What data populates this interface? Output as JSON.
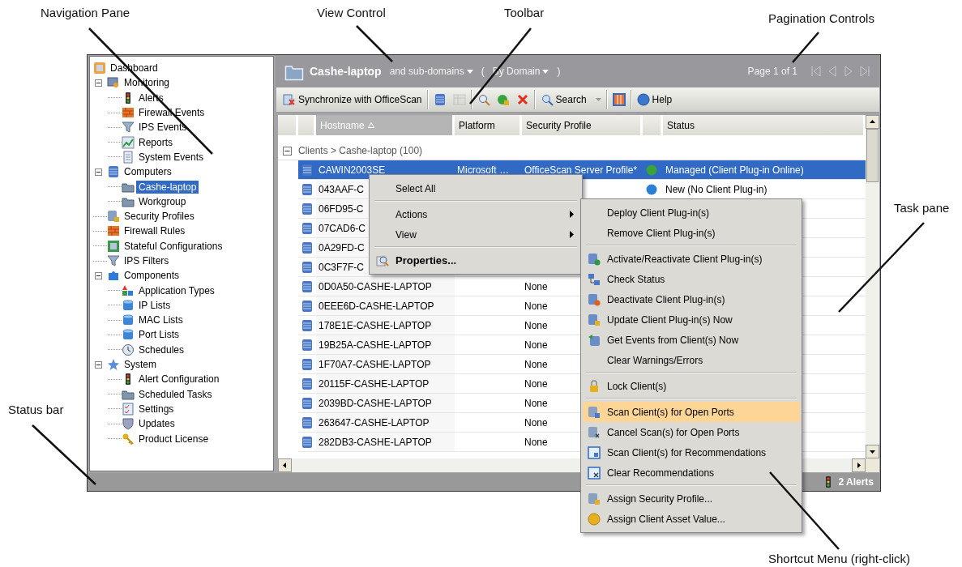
{
  "annotations": [
    {
      "label": "Navigation Pane"
    },
    {
      "label": "View Control"
    },
    {
      "label": "Toolbar"
    },
    {
      "label": "Pagination Controls"
    },
    {
      "label": "Task pane"
    },
    {
      "label": "Status bar"
    },
    {
      "label": "Shortcut Menu (right-click)"
    }
  ],
  "navigation": {
    "root": {
      "label": "Dashboard",
      "selected": false
    },
    "items": [
      {
        "label": "Monitoring",
        "selected": false,
        "expanded": true,
        "children": [
          {
            "label": "Alerts",
            "selected": false
          },
          {
            "label": "Firewall Events",
            "selected": false
          },
          {
            "label": "IPS Events",
            "selected": false
          },
          {
            "label": "Reports",
            "selected": false
          },
          {
            "label": "System Events",
            "selected": false
          }
        ]
      },
      {
        "label": "Computers",
        "selected": false,
        "expanded": true,
        "children": [
          {
            "label": "Cashe-laptop",
            "selected": true
          },
          {
            "label": "Workgroup",
            "selected": false
          }
        ]
      },
      {
        "label": "Security Profiles",
        "selected": false
      },
      {
        "label": "Firewall Rules",
        "selected": false
      },
      {
        "label": "Stateful Configurations",
        "selected": false
      },
      {
        "label": "IPS Filters",
        "selected": false
      },
      {
        "label": "Components",
        "selected": false,
        "expanded": true,
        "children": [
          {
            "label": "Application Types",
            "selected": false
          },
          {
            "label": "IP Lists",
            "selected": false
          },
          {
            "label": "MAC Lists",
            "selected": false
          },
          {
            "label": "Port Lists",
            "selected": false
          },
          {
            "label": "Schedules",
            "selected": false
          }
        ]
      },
      {
        "label": "System",
        "selected": false,
        "expanded": true,
        "children": [
          {
            "label": "Alert Configuration",
            "selected": false
          },
          {
            "label": "Scheduled Tasks",
            "selected": false
          },
          {
            "label": "Settings",
            "selected": false
          },
          {
            "label": "Updates",
            "selected": false
          },
          {
            "label": "Product License",
            "selected": false
          }
        ]
      }
    ]
  },
  "header": {
    "title": "Cashe-laptop",
    "scope": "and sub-domains",
    "group_open": "(",
    "group_by": "By Domain",
    "group_close": ")",
    "page": "Page 1 of 1"
  },
  "toolbar": [
    {
      "kind": "text",
      "label": "Synchronize with OfficeScan",
      "disabled": false
    },
    {
      "kind": "separator"
    },
    {
      "kind": "icon",
      "disabled": false
    },
    {
      "kind": "icon",
      "disabled": true
    },
    {
      "kind": "separator"
    },
    {
      "kind": "icon",
      "disabled": false
    },
    {
      "kind": "icon",
      "disabled": false
    },
    {
      "kind": "icon",
      "disabled": false
    },
    {
      "kind": "separator"
    },
    {
      "kind": "dropdown",
      "label": "Search",
      "disabled": false
    },
    {
      "kind": "separator"
    },
    {
      "kind": "icon",
      "disabled": false
    },
    {
      "kind": "separator"
    },
    {
      "kind": "text",
      "label": "Help",
      "disabled": false
    }
  ],
  "table": {
    "columns": [
      {
        "label": "Hostname",
        "sorted": true
      },
      {
        "label": "Platform",
        "sorted": false
      },
      {
        "label": "Security Profile",
        "sorted": false
      },
      {
        "label": "Status",
        "sorted": false
      }
    ],
    "group": {
      "label": "Clients > Cashe-laptop (100)",
      "expanded": true
    },
    "rows": [
      {
        "hostname": "CAWIN2003SE",
        "platform": "Microsoft …",
        "profile": "OfficeScan Server Profile*",
        "status": "Managed (Client Plug-in Online)",
        "color": "#3aa33a",
        "selected": true
      },
      {
        "hostname": "043AAF-C",
        "status": "New (No Client Plug-in)",
        "color": "#2d7fd6",
        "selected": false
      },
      {
        "hostname": "06FD95-C",
        "selected": false
      },
      {
        "hostname": "07CAD6-C",
        "selected": false
      },
      {
        "hostname": "0A29FD-C",
        "selected": false
      },
      {
        "hostname": "0C3F7F-C",
        "selected": false
      },
      {
        "hostname": "0D0A50-CASHE-LAPTOP",
        "profile": "None",
        "selected": false
      },
      {
        "hostname": "0EEE6D-CASHE-LAPTOP",
        "profile": "None",
        "selected": false
      },
      {
        "hostname": "178E1E-CASHE-LAPTOP",
        "profile": "None",
        "selected": false
      },
      {
        "hostname": "19B25A-CASHE-LAPTOP",
        "profile": "None",
        "selected": false
      },
      {
        "hostname": "1F70A7-CASHE-LAPTOP",
        "profile": "None",
        "selected": false
      },
      {
        "hostname": "20115F-CASHE-LAPTOP",
        "profile": "None",
        "selected": false
      },
      {
        "hostname": "2039BD-CASHE-LAPTOP",
        "profile": "None",
        "selected": false
      },
      {
        "hostname": "263647-CASHE-LAPTOP",
        "profile": "None",
        "selected": false
      },
      {
        "hostname": "282DB3-CASHE-LAPTOP",
        "profile": "None",
        "selected": false
      }
    ]
  },
  "status_bar": {
    "alerts": "2 Alerts"
  },
  "context_menu": {
    "items": [
      {
        "kind": "item",
        "label": "Select All",
        "submenu": false,
        "default": false
      },
      {
        "kind": "separator"
      },
      {
        "kind": "item",
        "label": "Actions",
        "submenu": true,
        "default": false
      },
      {
        "kind": "item",
        "label": "View",
        "submenu": true,
        "default": false
      },
      {
        "kind": "separator"
      },
      {
        "kind": "item",
        "label": "Properties...",
        "submenu": false,
        "default": true
      }
    ]
  },
  "submenu": {
    "items": [
      {
        "kind": "item",
        "label": "Deploy Client Plug-in(s)",
        "selected": false
      },
      {
        "kind": "item",
        "label": "Remove Client Plug-in(s)",
        "selected": false
      },
      {
        "kind": "separator"
      },
      {
        "kind": "item",
        "label": "Activate/Reactivate Client Plug-in(s)",
        "selected": false
      },
      {
        "kind": "item",
        "label": "Check Status",
        "selected": false
      },
      {
        "kind": "item",
        "label": "Deactivate Client Plug-in(s)",
        "selected": false
      },
      {
        "kind": "item",
        "label": "Update Client Plug-in(s) Now",
        "selected": false
      },
      {
        "kind": "item",
        "label": "Get Events from Client(s) Now",
        "selected": false
      },
      {
        "kind": "item",
        "label": "Clear Warnings/Errors",
        "selected": false
      },
      {
        "kind": "separator"
      },
      {
        "kind": "item",
        "label": "Lock Client(s)",
        "selected": false
      },
      {
        "kind": "separator"
      },
      {
        "kind": "item",
        "label": "Scan Client(s) for Open Ports",
        "selected": true
      },
      {
        "kind": "item",
        "label": "Cancel Scan(s) for Open Ports",
        "selected": false
      },
      {
        "kind": "item",
        "label": "Scan Client(s) for Recommendations",
        "selected": false
      },
      {
        "kind": "item",
        "label": "Clear Recommendations",
        "selected": false
      },
      {
        "kind": "separator"
      },
      {
        "kind": "item",
        "label": "Assign Security Profile...",
        "selected": false
      },
      {
        "kind": "item",
        "label": "Assign Client Asset Value...",
        "selected": false
      }
    ]
  }
}
